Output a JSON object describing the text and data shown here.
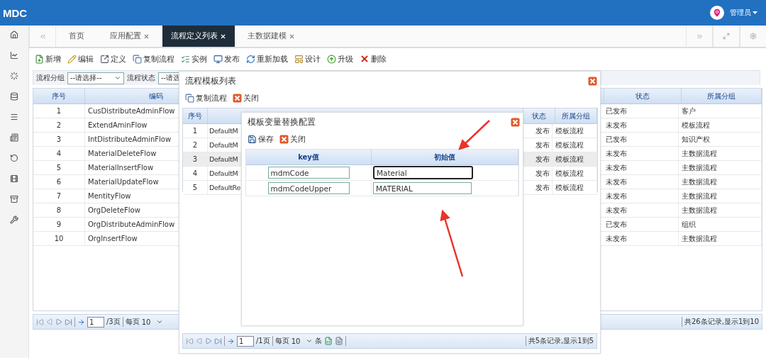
{
  "app": {
    "logo": "MDC",
    "user": "管理员"
  },
  "tabs": [
    {
      "label": "首页",
      "closable": false,
      "selected": false
    },
    {
      "label": "应用配置",
      "closable": true,
      "selected": false
    },
    {
      "label": "流程定义列表",
      "closable": true,
      "selected": true
    },
    {
      "label": "主数据建模",
      "closable": true,
      "selected": false
    }
  ],
  "toolbar": [
    {
      "label": "新增",
      "kind": "add"
    },
    {
      "label": "编辑",
      "kind": "edit"
    },
    {
      "label": "定义",
      "kind": "define"
    },
    {
      "label": "复制流程",
      "kind": "copy"
    },
    {
      "label": "实例",
      "kind": "list"
    },
    {
      "label": "发布",
      "kind": "publish"
    },
    {
      "label": "重新加载",
      "kind": "reload"
    },
    {
      "label": "设计",
      "kind": "design"
    },
    {
      "label": "升级",
      "kind": "upgrade"
    },
    {
      "label": "删除",
      "kind": "delete"
    }
  ],
  "filters": [
    {
      "label": "流程分组",
      "value": "--请选择--"
    },
    {
      "label": "流程状态",
      "value": "--请选"
    }
  ],
  "table": {
    "columns": [
      "序号",
      "编码",
      "状态",
      "所属分组"
    ],
    "rows": [
      {
        "no": "1",
        "code": "CusDistributeAdminFlow",
        "status": "已发布",
        "group": "客户"
      },
      {
        "no": "2",
        "code": "ExtendAminFlow",
        "status": "未发布",
        "group": "模板流程"
      },
      {
        "no": "3",
        "code": "IntDistributeAdminFlow",
        "status": "已发布",
        "group": "知识产权"
      },
      {
        "no": "4",
        "code": "MaterialDeleteFlow",
        "status": "未发布",
        "group": "主数据流程"
      },
      {
        "no": "5",
        "code": "MaterialInsertFlow",
        "status": "未发布",
        "group": "主数据流程"
      },
      {
        "no": "6",
        "code": "MaterialUpdateFlow",
        "status": "未发布",
        "group": "主数据流程"
      },
      {
        "no": "7",
        "code": "MentityFlow",
        "status": "未发布",
        "group": "主数据流程"
      },
      {
        "no": "8",
        "code": "OrgDeleteFlow",
        "status": "未发布",
        "group": "主数据流程"
      },
      {
        "no": "9",
        "code": "OrgDistributeAdminFlow",
        "status": "已发布",
        "group": "组织"
      },
      {
        "no": "10",
        "code": "OrgInsertFlow",
        "status": "未发布",
        "group": "主数据流程"
      }
    ]
  },
  "pager": {
    "page": "1",
    "pages": "/3页",
    "per_page_label": "每页",
    "per_page": "10",
    "summary": "共26条记录,显示1到10"
  },
  "template_dialog": {
    "title": "流程模板列表",
    "toolbar": [
      {
        "label": "复制流程",
        "kind": "copy"
      },
      {
        "label": "关闭",
        "kind": "close"
      }
    ],
    "table": {
      "columns": [
        "序号",
        "状态",
        "所属分组"
      ],
      "rows": [
        {
          "no": "1",
          "name": "DefaultM",
          "status": "发布",
          "group": "模板流程",
          "selected": false
        },
        {
          "no": "2",
          "name": "DefaultM",
          "status": "发布",
          "group": "模板流程",
          "selected": false
        },
        {
          "no": "3",
          "name": "DefaultM",
          "status": "发布",
          "group": "模板流程",
          "selected": true
        },
        {
          "no": "4",
          "name": "DefaultM",
          "status": "发布",
          "group": "模板流程",
          "selected": false
        },
        {
          "no": "5",
          "name": "DefaultRe",
          "status": "发布",
          "group": "模板流程",
          "selected": false
        }
      ]
    },
    "pager": {
      "page": "1",
      "pages": "/1页",
      "per_page_label": "每页",
      "per_page": "10",
      "unit": "条",
      "summary": "共5条记录,显示1到5"
    }
  },
  "variable_dialog": {
    "title": "模板变量替换配置",
    "toolbar": [
      {
        "label": "保存",
        "kind": "save"
      },
      {
        "label": "关闭",
        "kind": "close"
      }
    ],
    "columns": [
      "key值",
      "初始值"
    ],
    "rows": [
      {
        "key": "mdmCode",
        "value": "Material",
        "focused": true
      },
      {
        "key": "mdmCodeUpper",
        "value": "MATERIAL",
        "focused": false
      }
    ]
  }
}
